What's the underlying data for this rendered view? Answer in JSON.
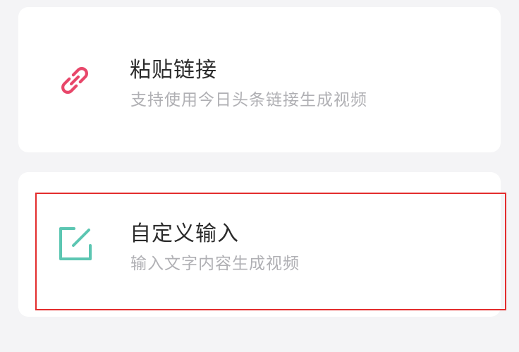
{
  "options": {
    "paste_link": {
      "title": "粘贴链接",
      "subtitle": "支持使用今日头条链接生成视频",
      "icon": "link-icon",
      "icon_color": "#e8476a"
    },
    "custom_input": {
      "title": "自定义输入",
      "subtitle": "输入文字内容生成视频",
      "icon": "edit-icon",
      "icon_color": "#5cc6b2"
    }
  },
  "colors": {
    "background": "#f4f4f6",
    "card": "#ffffff",
    "highlight_border": "#e32d2d"
  }
}
